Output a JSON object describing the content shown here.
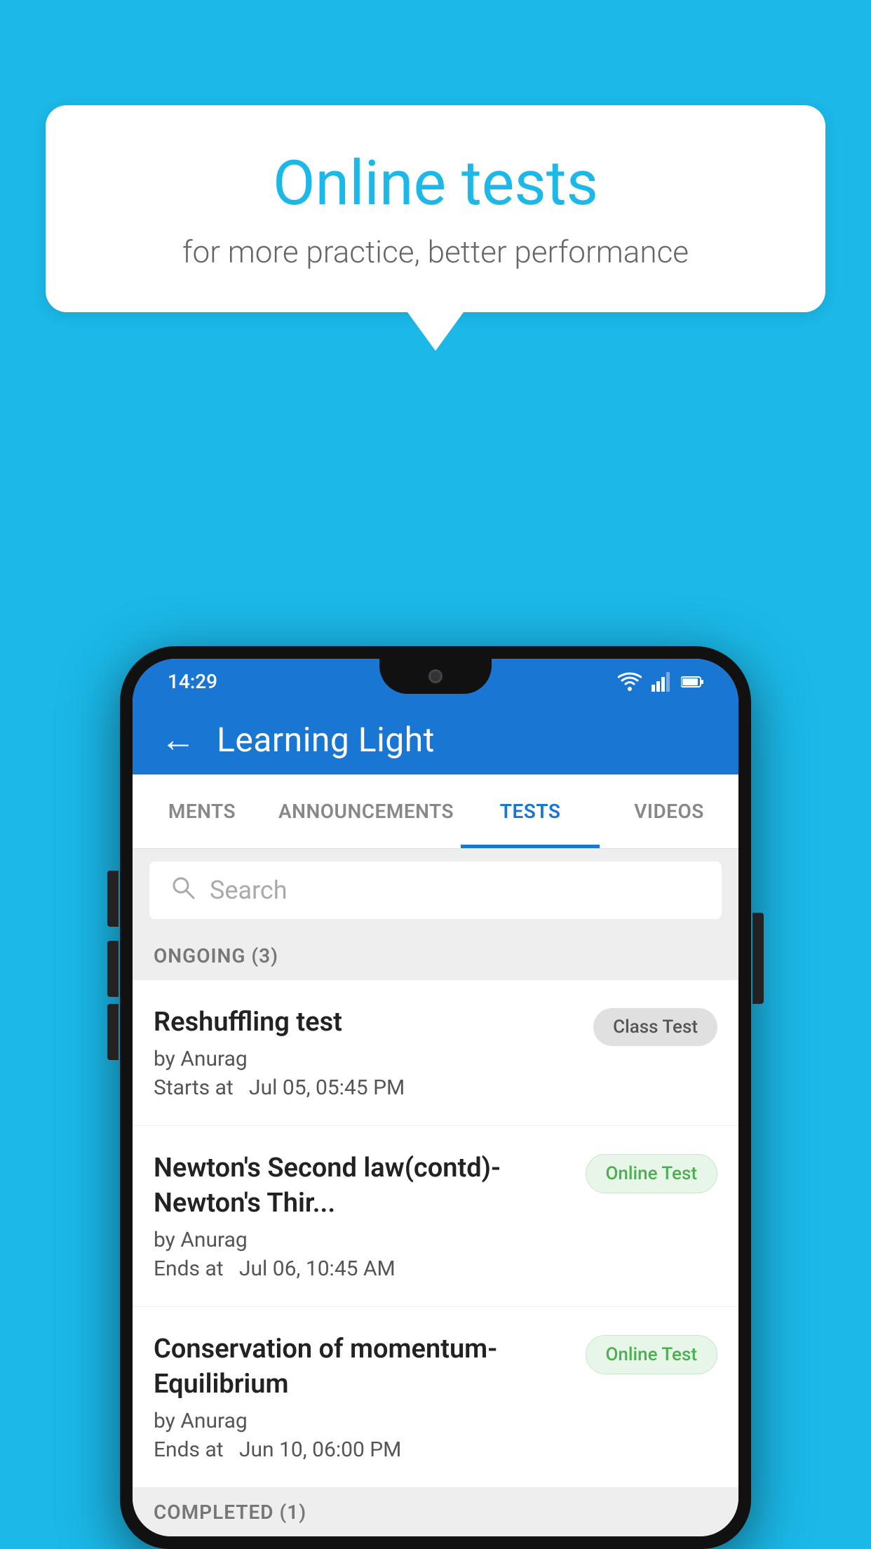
{
  "background": {
    "color": "#1bb8e8"
  },
  "speech_bubble": {
    "title": "Online tests",
    "subtitle": "for more practice, better performance"
  },
  "phone": {
    "status_bar": {
      "time": "14:29",
      "icons": [
        "wifi",
        "signal",
        "battery"
      ]
    },
    "top_bar": {
      "back_label": "←",
      "title": "Learning Light"
    },
    "tabs": [
      {
        "label": "MENTS",
        "active": false
      },
      {
        "label": "ANNOUNCEMENTS",
        "active": false
      },
      {
        "label": "TESTS",
        "active": true
      },
      {
        "label": "VIDEOS",
        "active": false
      }
    ],
    "search": {
      "placeholder": "Search"
    },
    "section_ongoing": {
      "label": "ONGOING (3)"
    },
    "tests_ongoing": [
      {
        "title": "Reshuffling test",
        "author": "by Anurag",
        "time_label": "Starts at",
        "time": "Jul 05, 05:45 PM",
        "badge": "Class Test",
        "badge_type": "class"
      },
      {
        "title": "Newton's Second law(contd)-Newton's Thir...",
        "author": "by Anurag",
        "time_label": "Ends at",
        "time": "Jul 06, 10:45 AM",
        "badge": "Online Test",
        "badge_type": "online"
      },
      {
        "title": "Conservation of momentum-Equilibrium",
        "author": "by Anurag",
        "time_label": "Ends at",
        "time": "Jun 10, 06:00 PM",
        "badge": "Online Test",
        "badge_type": "online"
      }
    ],
    "section_completed": {
      "label": "COMPLETED (1)"
    }
  }
}
